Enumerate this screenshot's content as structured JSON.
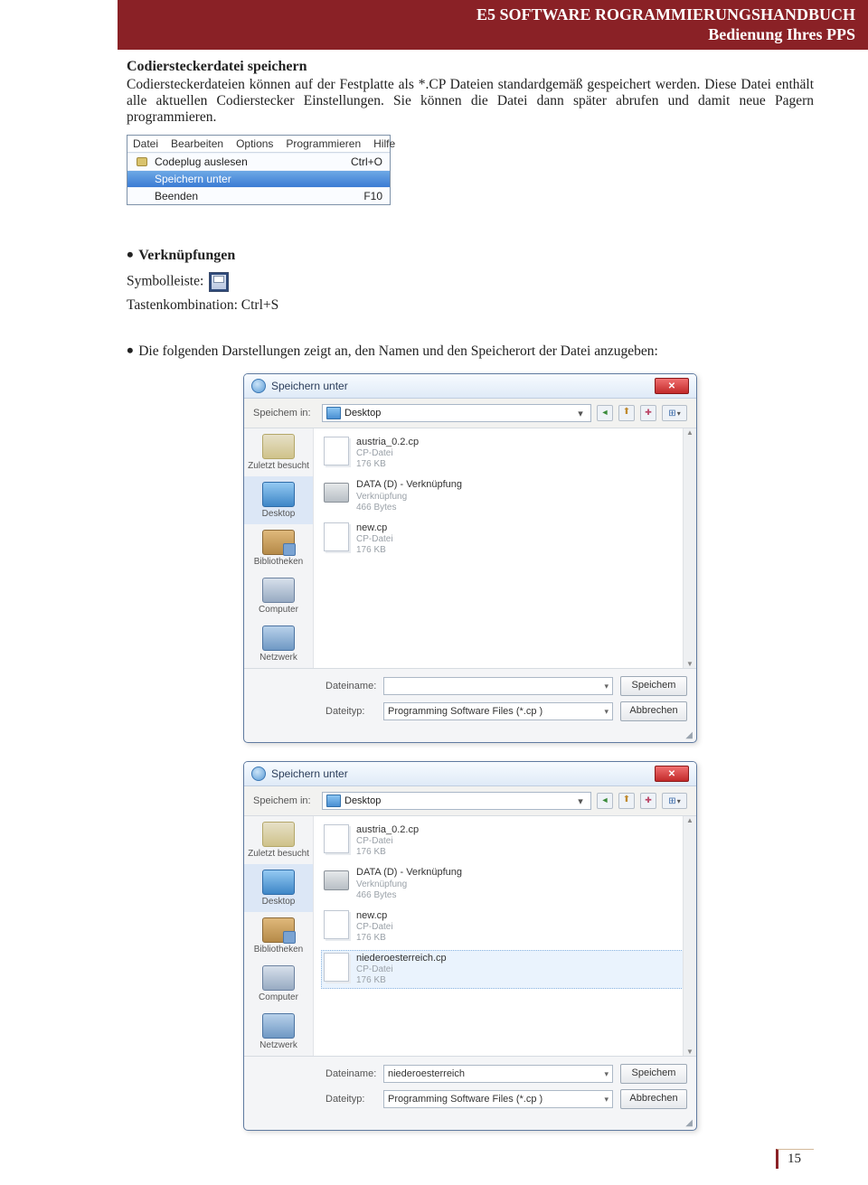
{
  "header": {
    "line1": "E5 SOFTWARE ROGRAMMIERUNGSHANDBUCH",
    "line2": "Bedienung Ihres PPS"
  },
  "section_title": "Codiersteckerdatei speichern",
  "body_text": "Codiersteckerdateien können auf der Festplatte als *.CP Dateien standardgemäß gespeichert werden. Diese Datei enthält alle aktuellen Codierstecker Einstellungen. Sie können die Datei dann später abrufen und damit neue Pagern programmieren.",
  "menu": {
    "bar": [
      "Datei",
      "Bearbeiten",
      "Options",
      "Programmieren",
      "Hilfe"
    ],
    "items": [
      {
        "label": "Codeplug auslesen",
        "shortcut": "Ctrl+O",
        "icon": true
      },
      {
        "label": "Speichern unter",
        "shortcut": "",
        "highlight": true
      },
      {
        "label": "Beenden",
        "shortcut": "F10"
      }
    ]
  },
  "links_heading": "Verknüpfungen",
  "toolbar_label": "Symbolleiste:",
  "shortcut_label": "Tastenkombination: Ctrl+S",
  "followup_text": "Die folgenden Darstellungen zeigt an, den Namen und den Speicherort der Datei anzugeben:",
  "dialog": {
    "title": "Speichern unter",
    "location_label": "Speichem in:",
    "location_value": "Desktop",
    "places": [
      {
        "id": "recent",
        "label": "Zuletzt besucht"
      },
      {
        "id": "desktop",
        "label": "Desktop",
        "selected": true
      },
      {
        "id": "libs",
        "label": "Bibliotheken"
      },
      {
        "id": "computer",
        "label": "Computer"
      },
      {
        "id": "network",
        "label": "Netzwerk"
      }
    ],
    "files_common": [
      {
        "icon": "doc",
        "name": "austria_0.2.cp",
        "sub1": "CP-Datei",
        "sub2": "176 KB"
      },
      {
        "icon": "drive",
        "name": "DATA (D) - Verknüpfung",
        "sub1": "Verknüpfung",
        "sub2": "466 Bytes"
      },
      {
        "icon": "doc",
        "name": "new.cp",
        "sub1": "CP-Datei",
        "sub2": "176 KB"
      }
    ],
    "file_selected": {
      "icon": "doc",
      "name": "niederoesterreich.cp",
      "sub1": "CP-Datei",
      "sub2": "176 KB"
    },
    "filename_label": "Dateiname:",
    "filetype_label": "Dateityp:",
    "filetype_value": "Programming Software Files (*.cp )",
    "save_btn": "Speichem",
    "cancel_btn": "Abbrechen",
    "filename_value_2": "niederoesterreich"
  },
  "page_number": "15"
}
